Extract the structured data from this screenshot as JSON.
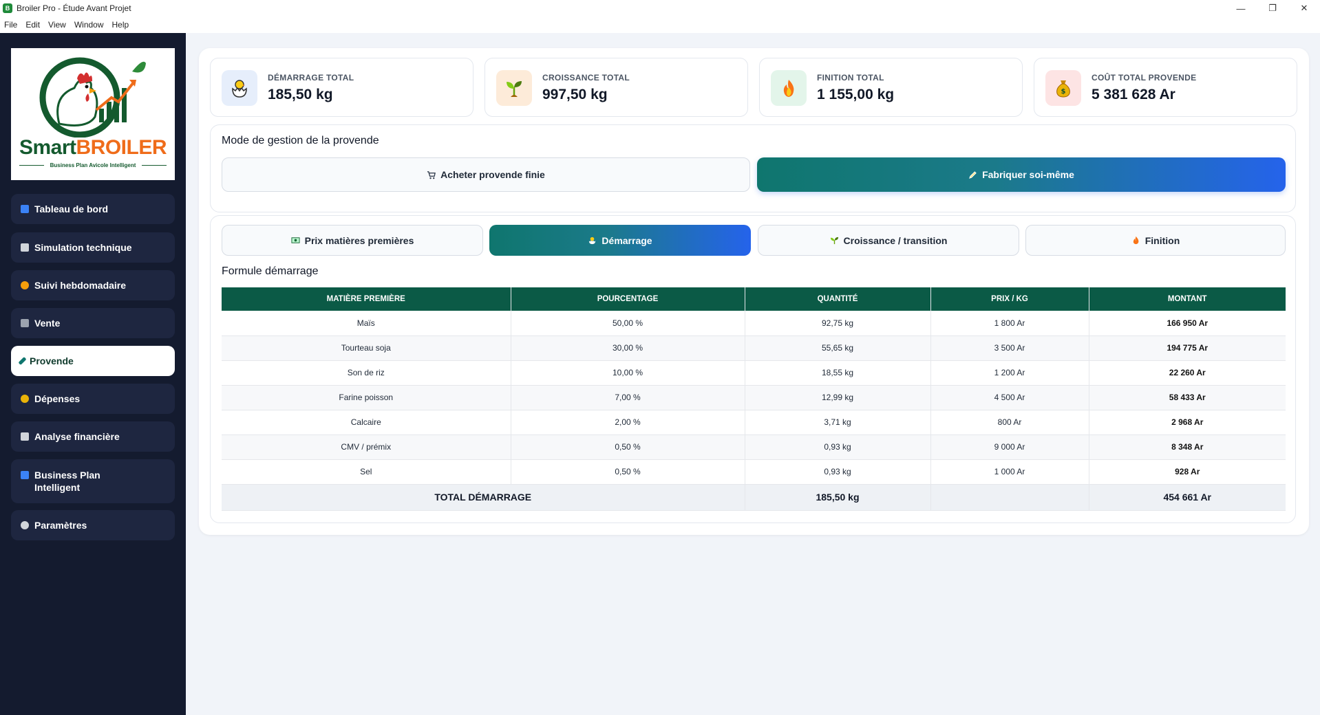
{
  "window": {
    "title": "Broiler Pro - Étude Avant Projet",
    "controls": {
      "minimize": "—",
      "maximize": "❐",
      "close": "✕"
    }
  },
  "menu": [
    "File",
    "Edit",
    "View",
    "Window",
    "Help"
  ],
  "logo": {
    "smart": "Smart",
    "broiler": "BROILER",
    "tagline": "Business Plan Avicole Intelligent"
  },
  "sidebar": {
    "items": [
      {
        "label": "Tableau de bord",
        "icon": "bar-chart-icon",
        "color": "#3b82f6"
      },
      {
        "label": "Simulation technique",
        "icon": "clipboard-icon",
        "color": "#d1d5db"
      },
      {
        "label": "Suivi hebdomadaire",
        "icon": "chick-icon",
        "color": "#f59e0b"
      },
      {
        "label": "Vente",
        "icon": "cart-icon",
        "color": "#9ca3af"
      },
      {
        "label": "Provende",
        "icon": "pencil-icon",
        "color": "#0f766e"
      },
      {
        "label": "Dépenses",
        "icon": "money-bag-icon",
        "color": "#eab308"
      },
      {
        "label": "Analyse financière",
        "icon": "printer-icon",
        "color": "#d1d5db"
      },
      {
        "label": "Business Plan Intelligent",
        "icon": "book-icon",
        "color": "#3b82f6"
      },
      {
        "label": "Paramètres",
        "icon": "gear-icon",
        "color": "#d1d5db"
      }
    ],
    "active_index": 4
  },
  "stats": [
    {
      "label": "DÉMARRAGE TOTAL",
      "value": "185,50 kg",
      "icon": "hatching-chick-icon",
      "bg": "#e6eefb"
    },
    {
      "label": "CROISSANCE TOTAL",
      "value": "997,50 kg",
      "icon": "seedling-icon",
      "bg": "#fdebd9"
    },
    {
      "label": "FINITION TOTAL",
      "value": "1 155,00 kg",
      "icon": "fire-icon",
      "bg": "#e3f5ea"
    },
    {
      "label": "COÛT TOTAL PROVENDE",
      "value": "5 381 628 Ar",
      "icon": "money-bag-icon",
      "bg": "#fde4e4"
    }
  ],
  "mode": {
    "title": "Mode de gestion de la provende",
    "buy_label": "Acheter provende finie",
    "make_label": "Fabriquer soi-même"
  },
  "tabs": {
    "prices": "Prix matières premières",
    "starter": "Démarrage",
    "growth": "Croissance / transition",
    "finish": "Finition"
  },
  "formula": {
    "title": "Formule démarrage",
    "headers": [
      "MATIÈRE PREMIÈRE",
      "POURCENTAGE",
      "QUANTITÉ",
      "PRIX / KG",
      "MONTANT"
    ],
    "rows": [
      [
        "Maïs",
        "50,00 %",
        "92,75 kg",
        "1 800 Ar",
        "166 950 Ar"
      ],
      [
        "Tourteau soja",
        "30,00 %",
        "55,65 kg",
        "3 500 Ar",
        "194 775 Ar"
      ],
      [
        "Son de riz",
        "10,00 %",
        "18,55 kg",
        "1 200 Ar",
        "22 260 Ar"
      ],
      [
        "Farine poisson",
        "7,00 %",
        "12,99 kg",
        "4 500 Ar",
        "58 433 Ar"
      ],
      [
        "Calcaire",
        "2,00 %",
        "3,71 kg",
        "800 Ar",
        "2 968 Ar"
      ],
      [
        "CMV / prémix",
        "0,50 %",
        "0,93 kg",
        "9 000 Ar",
        "8 348 Ar"
      ],
      [
        "Sel",
        "0,50 %",
        "0,93 kg",
        "1 000 Ar",
        "928 Ar"
      ]
    ],
    "total": {
      "label": "TOTAL DÉMARRAGE",
      "quantity": "185,50 kg",
      "price": "",
      "amount": "454 661 Ar"
    }
  }
}
